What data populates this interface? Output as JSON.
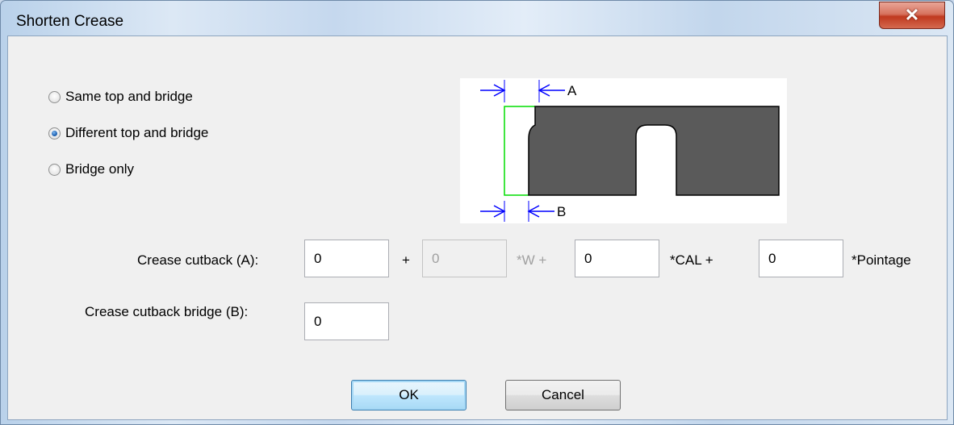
{
  "window": {
    "title": "Shorten Crease",
    "close_glyph": "✕"
  },
  "options": [
    {
      "label": "Same top and bridge",
      "checked": false
    },
    {
      "label": "Different top and bridge",
      "checked": true
    },
    {
      "label": "Bridge only",
      "checked": false
    }
  ],
  "diagram": {
    "label_a": "A",
    "label_b": "B",
    "fill_color": "#5a5a5a",
    "arrow_color": "#0000ff",
    "outline_color": "#00dd00"
  },
  "crease_cutback": {
    "label": "Crease cutback (A):",
    "value_a": "0",
    "plus": "+",
    "value_w": "0",
    "w_suffix": "*W +",
    "value_cal": "0",
    "cal_suffix": "*CAL +",
    "value_pointage": "0",
    "pointage_suffix": "*Pointage"
  },
  "crease_bridge": {
    "label": "Crease cutback bridge (B):",
    "value": "0"
  },
  "buttons": {
    "ok": "OK",
    "cancel": "Cancel"
  }
}
